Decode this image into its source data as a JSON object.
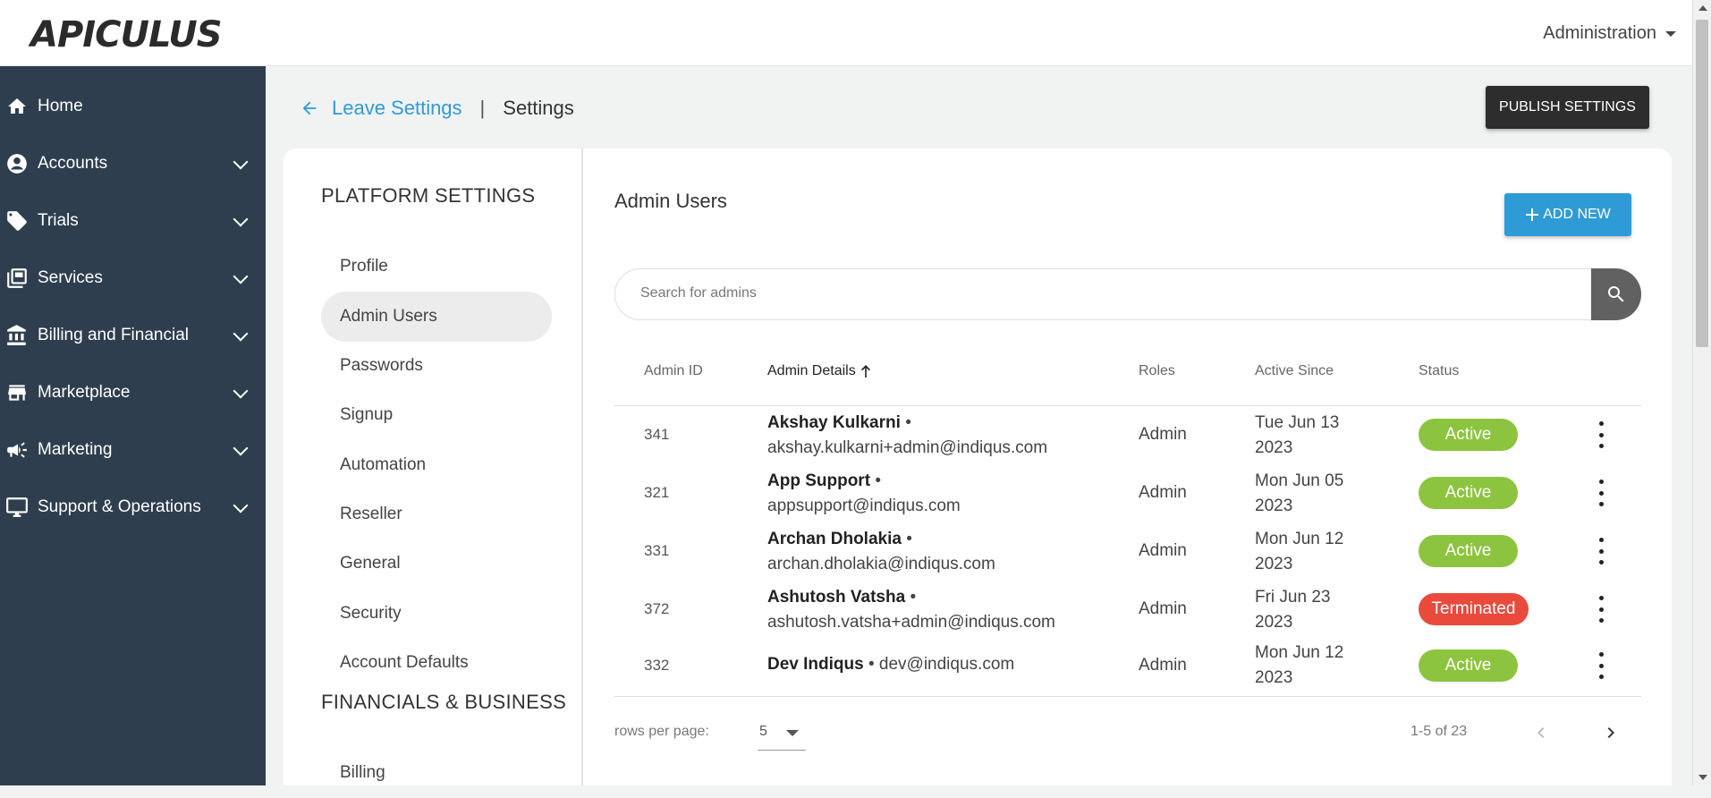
{
  "app": {
    "logo_text": "APICULUS",
    "admin_menu_label": "Administration"
  },
  "sidebar": {
    "items": [
      {
        "label": "Home",
        "icon": "home-icon"
      },
      {
        "label": "Accounts",
        "icon": "account-circle-icon"
      },
      {
        "label": "Trials",
        "icon": "tag-icon"
      },
      {
        "label": "Services",
        "icon": "services-icon"
      },
      {
        "label": "Billing and Financial",
        "icon": "bank-icon"
      },
      {
        "label": "Marketplace",
        "icon": "store-icon"
      },
      {
        "label": "Marketing",
        "icon": "megaphone-icon"
      },
      {
        "label": "Support & Operations",
        "icon": "monitor-icon"
      }
    ]
  },
  "header": {
    "back_label": "Leave Settings",
    "separator": "|",
    "current": "Settings",
    "publish_label": "PUBLISH SETTINGS"
  },
  "settings_menu": {
    "platform_title": "PLATFORM SETTINGS",
    "items": [
      "Profile",
      "Admin Users",
      "Passwords",
      "Signup",
      "Automation",
      "Reseller",
      "General",
      "Security",
      "Account Defaults"
    ],
    "active": "Admin Users",
    "financials_title": "FINANCIALS & BUSINESS",
    "financial_items": [
      "Billing"
    ]
  },
  "admin_users": {
    "title": "Admin Users",
    "add_label": "ADD NEW",
    "search_placeholder": "Search for admins",
    "columns": {
      "id": "Admin ID",
      "details": "Admin Details",
      "roles": "Roles",
      "since": "Active Since",
      "status": "Status"
    },
    "rows": [
      {
        "id": "341",
        "name": "Akshay Kulkarni",
        "email": "akshay.kulkarni+admin@indiqus.com",
        "role": "Admin",
        "since_1": "Tue Jun 13",
        "since_2": "2023",
        "status": "Active"
      },
      {
        "id": "321",
        "name": "App Support",
        "email": "appsupport@indiqus.com",
        "role": "Admin",
        "since_1": "Mon Jun 05",
        "since_2": "2023",
        "status": "Active"
      },
      {
        "id": "331",
        "name": "Archan Dholakia",
        "email": "archan.dholakia@indiqus.com",
        "role": "Admin",
        "since_1": "Mon Jun 12",
        "since_2": "2023",
        "status": "Active"
      },
      {
        "id": "372",
        "name": "Ashutosh Vatsha",
        "email": "ashutosh.vatsha+admin@indiqus.com",
        "role": "Admin",
        "since_1": "Fri Jun 23",
        "since_2": "2023",
        "status": "Terminated"
      },
      {
        "id": "332",
        "name": "Dev Indiqus",
        "email": "dev@indiqus.com",
        "role": "Admin",
        "since_1": "Mon Jun 12",
        "since_2": "2023",
        "status": "Active"
      }
    ],
    "rows_per_page_label": "rows per page:",
    "rows_per_page": "5",
    "page_info": "1-5 of 23"
  },
  "colors": {
    "sidebar": "#2e3e4e",
    "accent": "#2f9bd6",
    "active": "#8dc43f",
    "terminated": "#e94a3c"
  }
}
